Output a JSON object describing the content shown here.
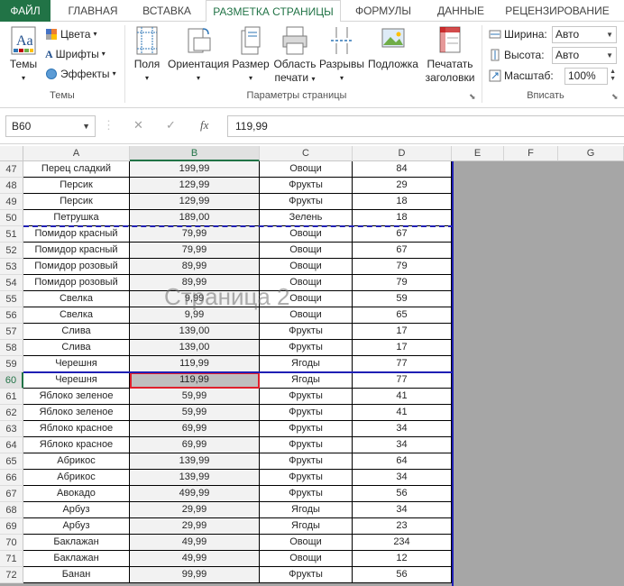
{
  "tabs": [
    {
      "label": "ФАЙЛ",
      "active": false
    },
    {
      "label": "ГЛАВНАЯ",
      "active": false
    },
    {
      "label": "ВСТАВКА",
      "active": false
    },
    {
      "label": "РАЗМЕТКА СТРАНИЦЫ",
      "active": true
    },
    {
      "label": "ФОРМУЛЫ",
      "active": false
    },
    {
      "label": "ДАННЫЕ",
      "active": false
    },
    {
      "label": "РЕЦЕНЗИРОВАНИЕ",
      "active": false
    }
  ],
  "ribbon": {
    "themes": {
      "themes_label": "Темы",
      "colors_label": "Цвета",
      "fonts_label": "Шрифты",
      "effects_label": "Эффекты",
      "group_label": "Темы"
    },
    "page_setup": {
      "margins_label": "Поля",
      "orientation_label": "Ориентация",
      "size_label": "Размер",
      "print_area_label_1": "Область",
      "print_area_label_2": "печати",
      "breaks_label": "Разрывы",
      "background_label": "Подложка",
      "print_titles_label_1": "Печатать",
      "print_titles_label_2": "заголовки",
      "group_label": "Параметры страницы"
    },
    "scale_to_fit": {
      "width_label": "Ширина:",
      "width_value": "Авто",
      "height_label": "Высота:",
      "height_value": "Авто",
      "scale_label": "Масштаб:",
      "scale_value": "100%",
      "group_label": "Вписать"
    }
  },
  "formula_bar": {
    "name_box": "B60",
    "fx_label": "fx",
    "value": "119,99"
  },
  "columns": [
    "A",
    "B",
    "C",
    "D",
    "E",
    "F",
    "G"
  ],
  "selected_column": "B",
  "selected_row": "60",
  "watermark": "Страница 2",
  "rows": [
    {
      "num": "47",
      "a": "Перец сладкий",
      "b": "199,99",
      "c": "Овощи",
      "d": "84"
    },
    {
      "num": "48",
      "a": "Персик",
      "b": "129,99",
      "c": "Фрукты",
      "d": "29"
    },
    {
      "num": "49",
      "a": "Персик",
      "b": "129,99",
      "c": "Фрукты",
      "d": "18"
    },
    {
      "num": "50",
      "a": "Петрушка",
      "b": "189,00",
      "c": "Зелень",
      "d": "18"
    },
    {
      "num": "51",
      "a": "Помидор красный",
      "b": "79,99",
      "c": "Овощи",
      "d": "67"
    },
    {
      "num": "52",
      "a": "Помидор красный",
      "b": "79,99",
      "c": "Овощи",
      "d": "67"
    },
    {
      "num": "53",
      "a": "Помидор розовый",
      "b": "89,99",
      "c": "Овощи",
      "d": "79"
    },
    {
      "num": "54",
      "a": "Помидор розовый",
      "b": "89,99",
      "c": "Овощи",
      "d": "79"
    },
    {
      "num": "55",
      "a": "Свелка",
      "b": "9,99",
      "c": "Овощи",
      "d": "59"
    },
    {
      "num": "56",
      "a": "Свелка",
      "b": "9,99",
      "c": "Овощи",
      "d": "65"
    },
    {
      "num": "57",
      "a": "Слива",
      "b": "139,00",
      "c": "Фрукты",
      "d": "17"
    },
    {
      "num": "58",
      "a": "Слива",
      "b": "139,00",
      "c": "Фрукты",
      "d": "17"
    },
    {
      "num": "59",
      "a": "Черешня",
      "b": "119,99",
      "c": "Ягоды",
      "d": "77"
    },
    {
      "num": "60",
      "a": "Черешня",
      "b": "119,99",
      "c": "Ягоды",
      "d": "77"
    },
    {
      "num": "61",
      "a": "Яблоко зеленое",
      "b": "59,99",
      "c": "Фрукты",
      "d": "41"
    },
    {
      "num": "62",
      "a": "Яблоко зеленое",
      "b": "59,99",
      "c": "Фрукты",
      "d": "41"
    },
    {
      "num": "63",
      "a": "Яблоко красное",
      "b": "69,99",
      "c": "Фрукты",
      "d": "34"
    },
    {
      "num": "64",
      "a": "Яблоко красное",
      "b": "69,99",
      "c": "Фрукты",
      "d": "34"
    },
    {
      "num": "65",
      "a": "Абрикос",
      "b": "139,99",
      "c": "Фрукты",
      "d": "64"
    },
    {
      "num": "66",
      "a": "Абрикос",
      "b": "139,99",
      "c": "Фрукты",
      "d": "34"
    },
    {
      "num": "67",
      "a": "Авокадо",
      "b": "499,99",
      "c": "Фрукты",
      "d": "56"
    },
    {
      "num": "68",
      "a": "Арбуз",
      "b": "29,99",
      "c": "Ягоды",
      "d": "34"
    },
    {
      "num": "69",
      "a": "Арбуз",
      "b": "29,99",
      "c": "Ягоды",
      "d": "23"
    },
    {
      "num": "70",
      "a": "Баклажан",
      "b": "49,99",
      "c": "Овощи",
      "d": "234"
    },
    {
      "num": "71",
      "a": "Баклажан",
      "b": "49,99",
      "c": "Овощи",
      "d": "12"
    },
    {
      "num": "72",
      "a": "Банан",
      "b": "99,99",
      "c": "Фрукты",
      "d": "56"
    }
  ],
  "colors": {
    "accent": "#217346",
    "page_break": "#1f1fb4",
    "active_cell_border": "#e0202c"
  }
}
